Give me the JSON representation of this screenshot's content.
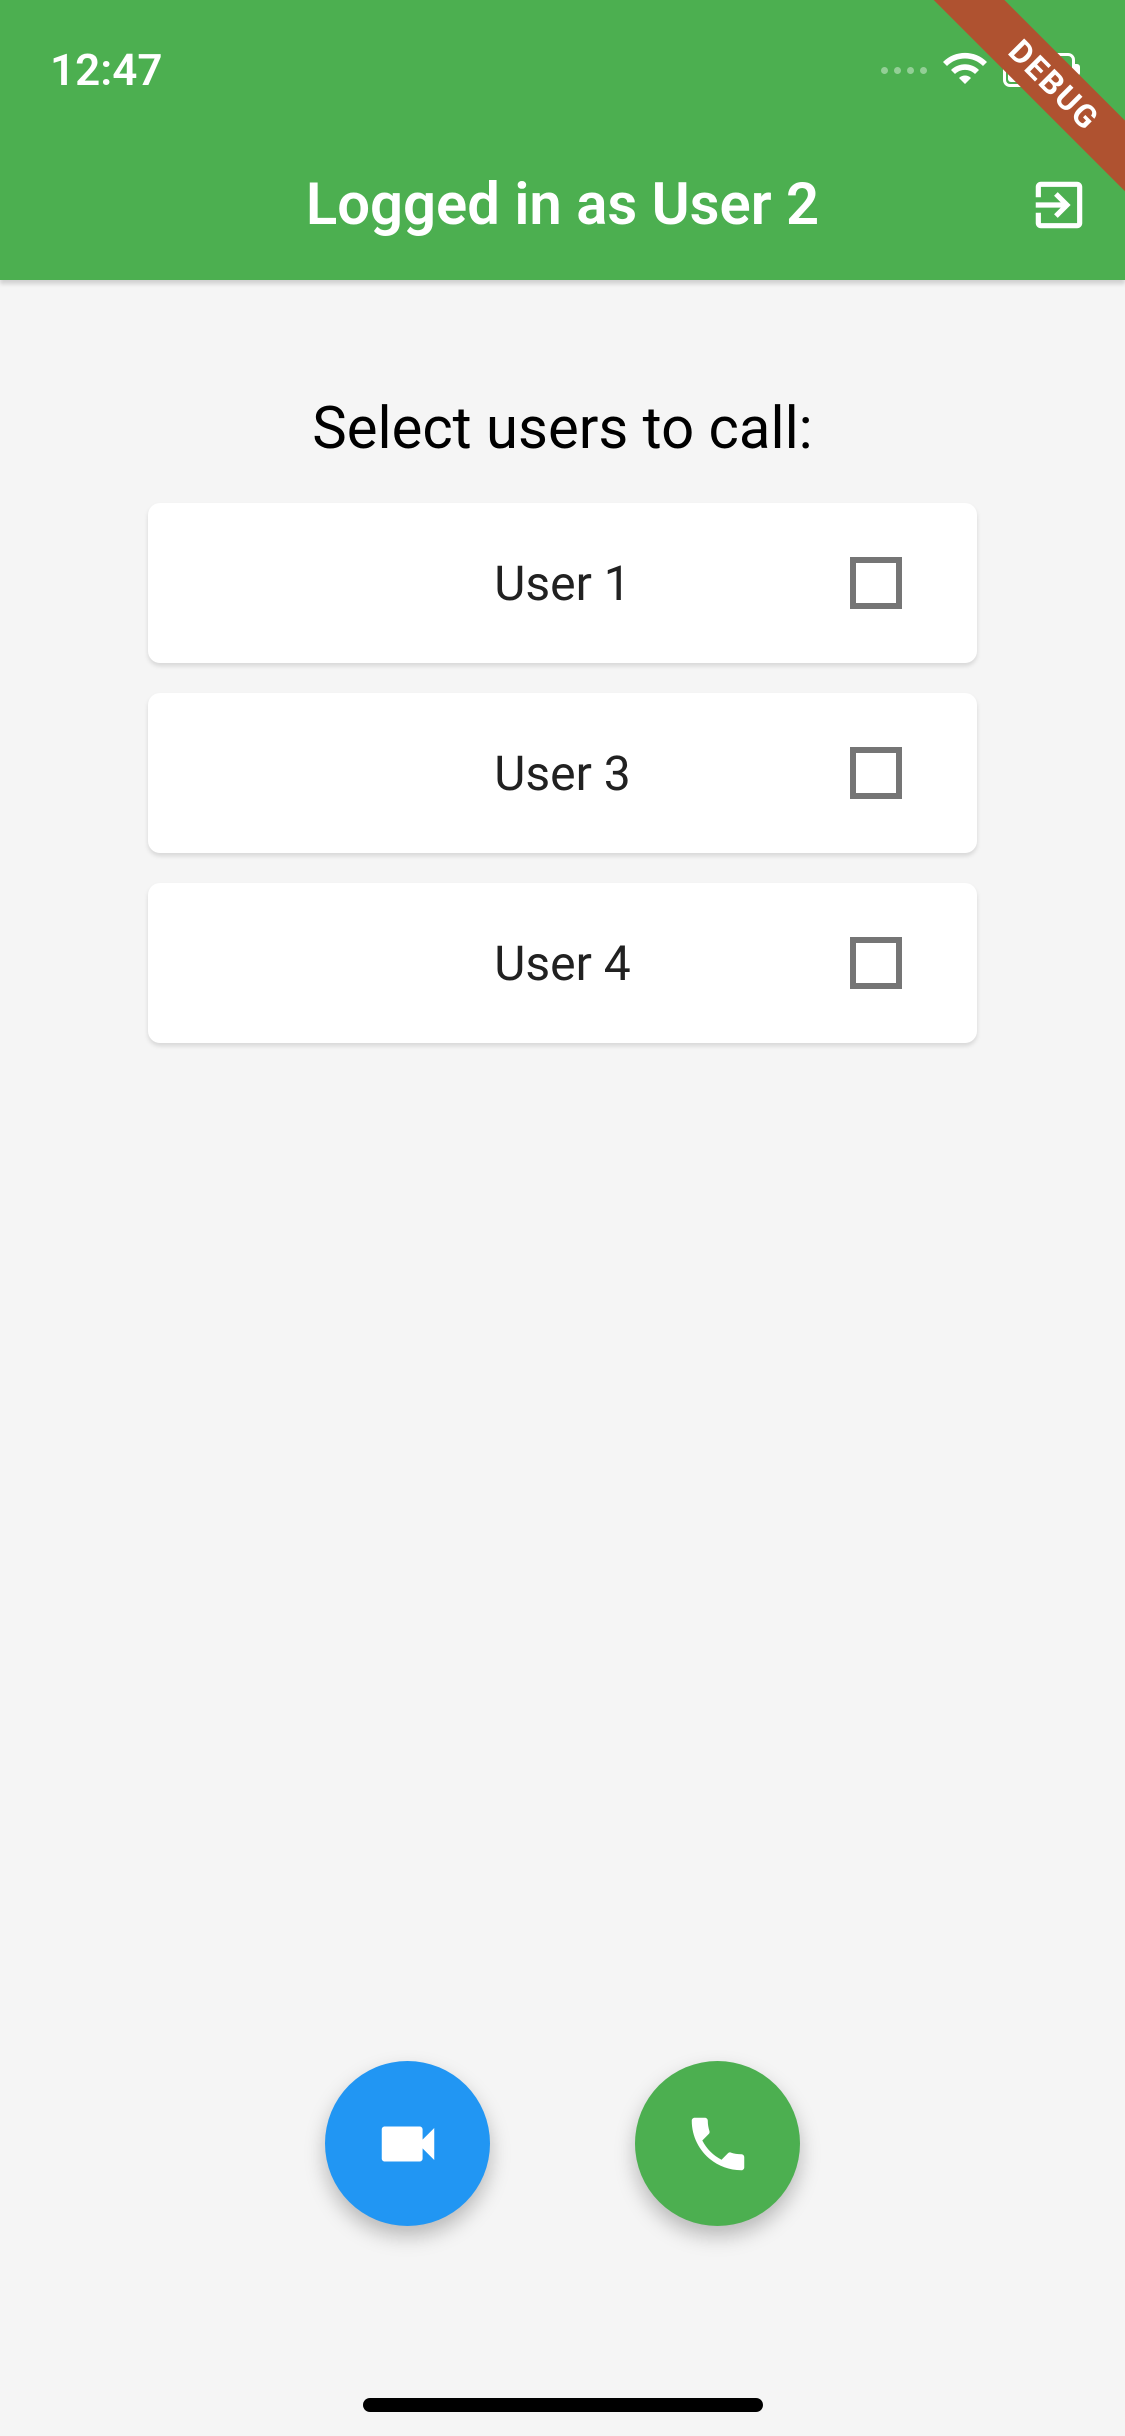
{
  "status_bar": {
    "time": "12:47"
  },
  "debug_banner": "DEBUG",
  "app_bar": {
    "title": "Logged in as User 2"
  },
  "main": {
    "section_title": "Select users to call:",
    "users": [
      {
        "label": "User 1",
        "checked": false
      },
      {
        "label": "User 3",
        "checked": false
      },
      {
        "label": "User 4",
        "checked": false
      }
    ]
  },
  "colors": {
    "primary": "#4caf50",
    "accent": "#2196f3"
  }
}
